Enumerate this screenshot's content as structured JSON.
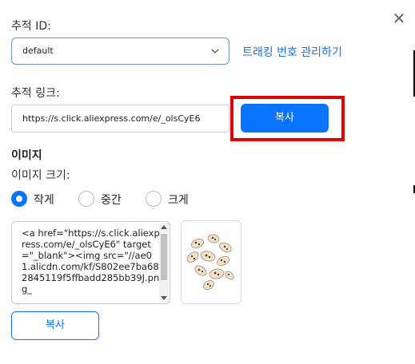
{
  "close_icon": "close-icon",
  "tracking_id": {
    "label": "추적 ID:",
    "selected": "default",
    "manage_link": "트래킹 번호 관리하기"
  },
  "tracking_link": {
    "label": "추적 링크:",
    "value": "https://s.click.aliexpress.com/e/_olsCyE6",
    "copy_label": "복사"
  },
  "image": {
    "section_title": "이미지",
    "size_label": "이미지 크기:",
    "sizes": [
      {
        "label": "작게",
        "checked": true
      },
      {
        "label": "중간",
        "checked": false
      },
      {
        "label": "크게",
        "checked": false
      }
    ],
    "code": "<a href=\"https://s.click.aliexpress.com/e/_olsCyE6\" target=\"_blank\"><img src=\"//ae01.alicdn.com/kf/S802ee7ba682845119f5ffbadd285bb39J.png_",
    "copy_label": "복사"
  },
  "colors": {
    "accent": "#0a74ff",
    "link": "#1a73e8",
    "highlight": "#e00000"
  }
}
